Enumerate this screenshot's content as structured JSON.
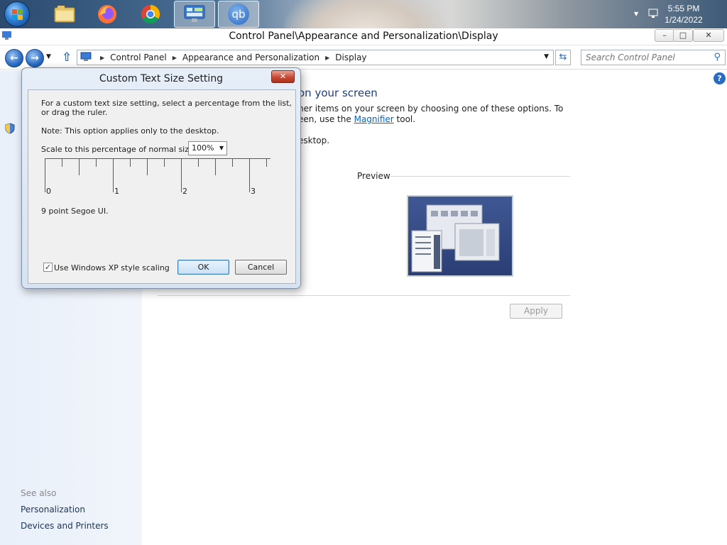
{
  "taskbar": {
    "apps": [
      "start",
      "file-explorer",
      "firefox",
      "chrome",
      "control-panel",
      "qbittorrent"
    ],
    "qb_label": "qb",
    "clock_time": "5:55 PM",
    "clock_date": "1/24/2022"
  },
  "window": {
    "title": "Control Panel\\Appearance and Personalization\\Display",
    "min": "–",
    "restore": "□",
    "close": "✕"
  },
  "address": {
    "crumbs": [
      "Control Panel",
      "Appearance and Personalization",
      "Display"
    ],
    "search_placeholder": "Search Control Panel"
  },
  "main": {
    "heading": "on your screen",
    "line1": "her items on your screen by choosing one of these options. To",
    "line2_pre": "een, use the ",
    "line2_link": "Magnifier",
    "line2_post": " tool.",
    "line3": "esktop.",
    "preview_label": "Preview",
    "apply_label": "Apply",
    "help": "?"
  },
  "sidebar": {
    "see_also": "See also",
    "links": [
      "Personalization",
      "Devices and Printers"
    ]
  },
  "dialog": {
    "title": "Custom Text Size Setting",
    "close": "✕",
    "instruction_line1": "For a custom text size setting, select a percentage from the list,",
    "instruction_line2": "or drag the ruler.",
    "note": "Note: This option applies only to the desktop.",
    "scale_label": "Scale to this percentage of normal size:",
    "scale_value": "100%",
    "ruler_numbers": [
      "0",
      "1",
      "2",
      "3"
    ],
    "font_info": "9 point Segoe UI.",
    "checkbox_label": "Use Windows XP style scaling",
    "checkbox_checked": true,
    "ok_label": "OK",
    "cancel_label": "Cancel"
  },
  "colors": {
    "accent": "#1e3f7a",
    "link": "#0066cc"
  }
}
